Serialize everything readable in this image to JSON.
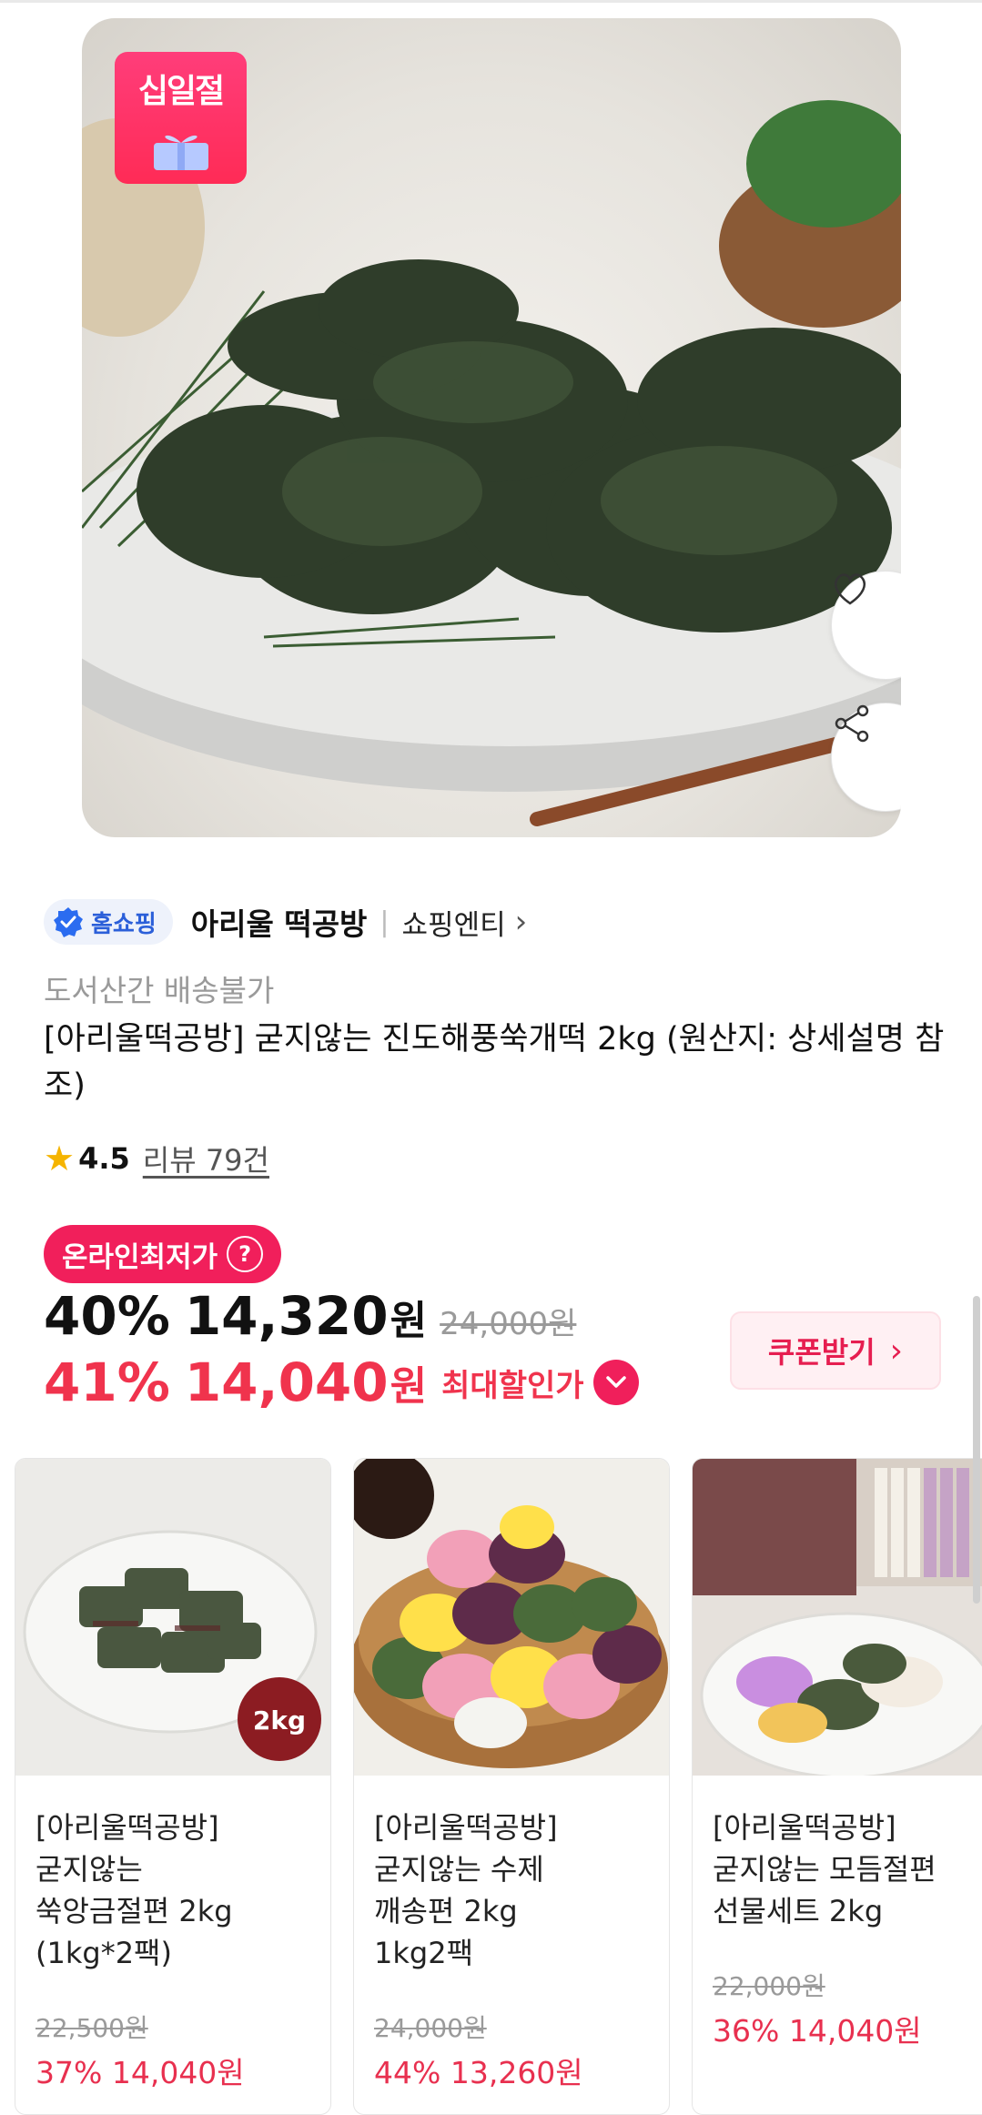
{
  "hero": {
    "badge_text": "십일절",
    "icons": {
      "like": "heart-icon",
      "share": "share-icon",
      "gift": "gift-icon"
    }
  },
  "store": {
    "type_badge": "홈쇼핑",
    "name": "아리울 떡공방",
    "separator": "|",
    "link_label": "쇼핑엔티",
    "link_chevron": "›"
  },
  "product": {
    "notice": "도서산간 배송불가",
    "title": "[아리울떡공방] 굳지않는 진도해풍쑥개떡 2kg (원산지: 상세설명 참조)",
    "rating": {
      "star": "★",
      "score": "4.5",
      "reviews": "리뷰 79건"
    }
  },
  "price": {
    "lowest_badge": "온라인최저가",
    "help_icon": "?",
    "discount_rate": "40%",
    "sale_price": "14,320",
    "currency": "원",
    "original_price": "24,000원",
    "max_rate": "41%",
    "max_price": "14,040",
    "max_label": "최대할인가"
  },
  "coupon": {
    "label": "쿠폰받기",
    "chevron": "›"
  },
  "recommendations": [
    {
      "name": "[아리울떡공방]\n굳지않는\n쑥앙금절편 2kg\n(1kg*2팩)",
      "size_badge": "2kg",
      "original_price": "22,500원",
      "sale": "37% 14,040원"
    },
    {
      "name": "[아리울떡공방]\n굳지않는 수제\n깨송편 2kg\n1kg2팩",
      "original_price": "24,000원",
      "sale": "44% 13,260원"
    },
    {
      "name": "[아리울떡공방]\n굳지않는 모듬절편\n선물세트 2kg",
      "original_price": "22,000원",
      "sale": "36% 14,040원"
    }
  ],
  "colors": {
    "accent": "#f11f5b",
    "price_red": "#f0334d",
    "verified_blue": "#2b5fd9",
    "star": "#f5b400"
  }
}
